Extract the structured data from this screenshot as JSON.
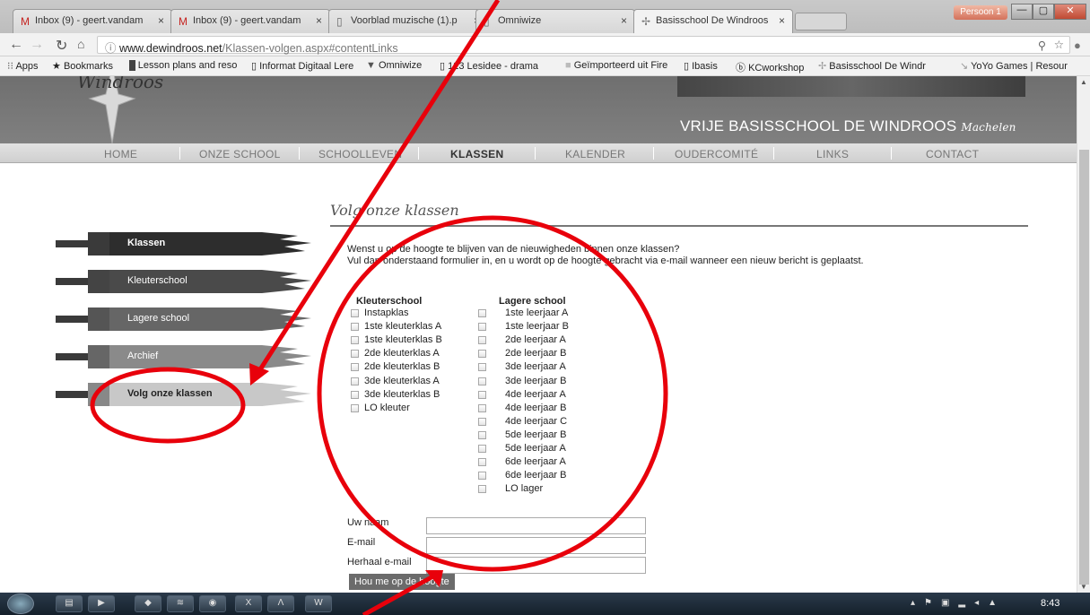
{
  "browser": {
    "tabs": [
      {
        "label": "Inbox (9) - geert.vandam",
        "icon": "gmail-icon"
      },
      {
        "label": "Inbox (9) - geert.vandam",
        "icon": "gmail-icon"
      },
      {
        "label": "Voorblad muzische (1).p",
        "icon": "document-icon"
      },
      {
        "label": "Omniwize",
        "icon": "document-icon"
      },
      {
        "label": "Basisschool De Windroos",
        "icon": "windroos-icon"
      }
    ],
    "profile": "Persoon 1",
    "url_host": "www.dewindroos.net",
    "url_path": "/Klassen-volgen.aspx#contentLinks",
    "bookmarks": [
      "Apps",
      "Bookmarks",
      "Lesson plans and reso",
      "Informat Digitaal Lere",
      "Omniwize",
      "123 Lesidee - drama",
      "Geïmporteerd uit Fire",
      "Ibasis",
      "KCworkshop",
      "Basisschool De Windr",
      "YoYo Games | Resour"
    ]
  },
  "site": {
    "logo_text": "Windroos",
    "school_name": "VRIJE BASISSCHOOL DE WINDROOS",
    "school_town": "Machelen",
    "menu": [
      "HOME",
      "ONZE SCHOOL",
      "SCHOOLLEVEN",
      "KLASSEN",
      "KALENDER",
      "OUDERCOMITÉ",
      "LINKS",
      "CONTACT"
    ],
    "active_menu": "KLASSEN"
  },
  "sidebar": [
    "Klassen",
    "Kleuterschool",
    "Lagere school",
    "Archief",
    "Volg onze klassen"
  ],
  "main": {
    "title": "Volg onze klassen",
    "intro_1": "Wenst u op de hoogte te blijven van de nieuwigheden binnen onze klassen?",
    "intro_2": "Vul dan onderstaand formulier in, en u wordt op de hoogte gebracht via e-mail wanneer een nieuw bericht is geplaatst.",
    "kleuter_head": "Kleuterschool",
    "kleuter": [
      "Instapklas",
      "1ste kleuterklas A",
      "1ste kleuterklas B",
      "2de kleuterklas A",
      "2de kleuterklas B",
      "3de kleuterklas A",
      "3de kleuterklas B",
      "LO kleuter"
    ],
    "lager_head": "Lagere school",
    "lager": [
      "1ste leerjaar A",
      "1ste leerjaar B",
      "2de leerjaar A",
      "2de leerjaar B",
      "3de leerjaar A",
      "3de leerjaar B",
      "4de leerjaar A",
      "4de leerjaar B",
      "4de leerjaar C",
      "5de leerjaar B",
      "5de leerjaar A",
      "6de leerjaar A",
      "6de leerjaar B",
      "LO lager"
    ],
    "form": {
      "name_label": "Uw naam",
      "email_label": "E-mail",
      "email2_label": "Herhaal e-mail",
      "submit": "Hou me op de hoogte"
    }
  },
  "taskbar": {
    "clock": "8:43"
  },
  "colors": {
    "annotation": "#e8000b",
    "header": "#7a7a7a",
    "menu_bar": "#d9d9d9"
  }
}
